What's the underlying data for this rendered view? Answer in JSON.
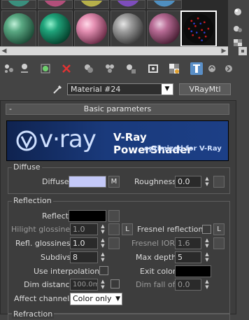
{
  "sample_slots": {
    "top_colors": [
      "#3a8f7d",
      "#b24f7a",
      "#b6b04a",
      "#7d4dbb",
      "#4f8fc0"
    ],
    "row_colors": [
      "#5aa983",
      "#1fa37a",
      "#e48fb2",
      "#9e9e9e",
      "#a8a04e",
      "#b86b95"
    ],
    "selected_slot_colors": [
      "#0b0b0b",
      "#c91c1c",
      "#2f3fd0"
    ]
  },
  "side_tools": [
    "sphere-options-icon",
    "backlight-icon",
    "background-checker-icon",
    "sample-uv-icon"
  ],
  "toolbar": {
    "icons": [
      "get-material-icon",
      "put-to-scene-icon",
      "assign-to-selection-icon",
      "reset-map-icon",
      "make-copy-icon",
      "make-unique-icon",
      "put-to-library-icon",
      "material-id-icon",
      "show-map-icon",
      "show-end-result-icon",
      "go-to-parent-icon",
      "go-forward-icon"
    ],
    "active_index": 10
  },
  "material": {
    "name": "Material #24",
    "type": "VRayMtl"
  },
  "rollout": {
    "title": "Basic parameters",
    "collapse_symbol": "-"
  },
  "banner": {
    "logo_text": "v·ray",
    "product": "V-Ray PowerShader",
    "tagline": "optimized for V-Ray"
  },
  "diffuse": {
    "group_label": "Diffuse",
    "diffuse_label": "Diffuse",
    "diffuse_color": "#c4c9f8",
    "map_label": "M",
    "roughness_label": "Roughness",
    "roughness_value": "0.0"
  },
  "reflection": {
    "group_label": "Reflection",
    "reflect_label": "Reflect",
    "reflect_color": "#000000",
    "hilight_label": "Hilight glossiness",
    "hilight_value": "1.0",
    "lock_label": "L",
    "fresnel_label": "Fresnel reflections",
    "fresnel_lock": "L",
    "refl_gloss_label": "Refl. glossiness",
    "refl_gloss_value": "1.0",
    "fresnel_ior_label": "Fresnel IOR",
    "fresnel_ior_value": "1.6",
    "subdivs_label": "Subdivs",
    "subdivs_value": "8",
    "max_depth_label": "Max depth",
    "max_depth_value": "5",
    "use_interp_label": "Use interpolation",
    "exit_color_label": "Exit color",
    "exit_color": "#000000",
    "dim_distance_label": "Dim distance",
    "dim_distance_value": "100.0m",
    "dim_falloff_label": "Dim fall off",
    "dim_falloff_value": "0.0",
    "affect_label": "Affect channels",
    "affect_value": "Color only"
  },
  "refraction": {
    "group_label": "Refraction"
  }
}
